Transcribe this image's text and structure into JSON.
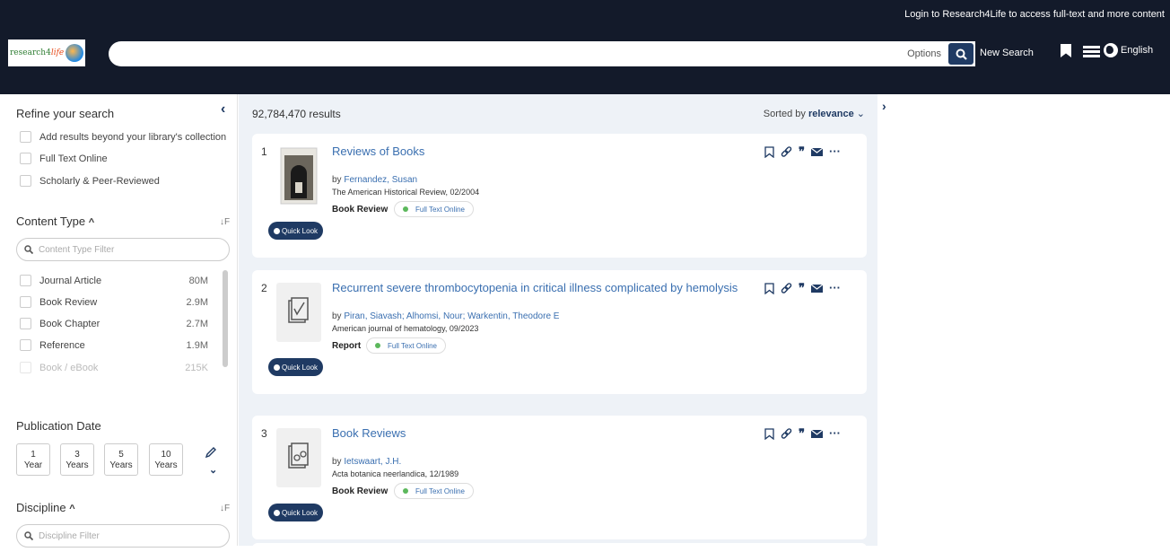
{
  "header": {
    "login_message": "Login to Research4Life to access full-text and more content",
    "logo_text_main": "research4",
    "logo_text_life": "life",
    "search_value": "",
    "options_label": "Options",
    "new_search_label": "New Search",
    "language_label": "English"
  },
  "sidebar": {
    "refine_title": "Refine your search",
    "refine_options": [
      "Add results beyond your library's collection",
      "Full Text Online",
      "Scholarly & Peer-Reviewed"
    ],
    "content_type": {
      "title": "Content Type",
      "filter_placeholder": "Content Type Filter",
      "items": [
        {
          "label": "Journal Article",
          "count": "80M"
        },
        {
          "label": "Book Review",
          "count": "2.9M"
        },
        {
          "label": "Book Chapter",
          "count": "2.7M"
        },
        {
          "label": "Reference",
          "count": "1.9M"
        },
        {
          "label": "Book / eBook",
          "count": "215K"
        }
      ]
    },
    "publication_date": {
      "title": "Publication Date",
      "buttons": [
        {
          "num": "1",
          "unit": "Year"
        },
        {
          "num": "3",
          "unit": "Years"
        },
        {
          "num": "5",
          "unit": "Years"
        },
        {
          "num": "10",
          "unit": "Years"
        }
      ]
    },
    "discipline": {
      "title": "Discipline",
      "filter_placeholder": "Discipline Filter"
    }
  },
  "main": {
    "result_count": "92,784,470 results",
    "sorted_by_label": "Sorted by",
    "sorted_by_value": "relevance",
    "quick_look_label": "Quick Look",
    "full_text_label": "Full Text Online",
    "results": [
      {
        "num": "1",
        "title": "Reviews of Books",
        "by": "by",
        "authors": "Fernandez, Susan",
        "source": "The American Historical Review, 02/2004",
        "type": "Book Review"
      },
      {
        "num": "2",
        "title": "Recurrent severe thrombocytopenia in critical illness complicated by hemolysis",
        "by": "by",
        "authors": "Piran, Siavash; Alhomsi, Nour; Warkentin, Theodore E",
        "source": "American journal of hematology, 09/2023",
        "type": "Report"
      },
      {
        "num": "3",
        "title": "Book Reviews",
        "by": "by",
        "authors": "Ietswaart, J.H.",
        "source": "Acta botanica neerlandica, 12/1989",
        "type": "Book Review"
      }
    ]
  }
}
